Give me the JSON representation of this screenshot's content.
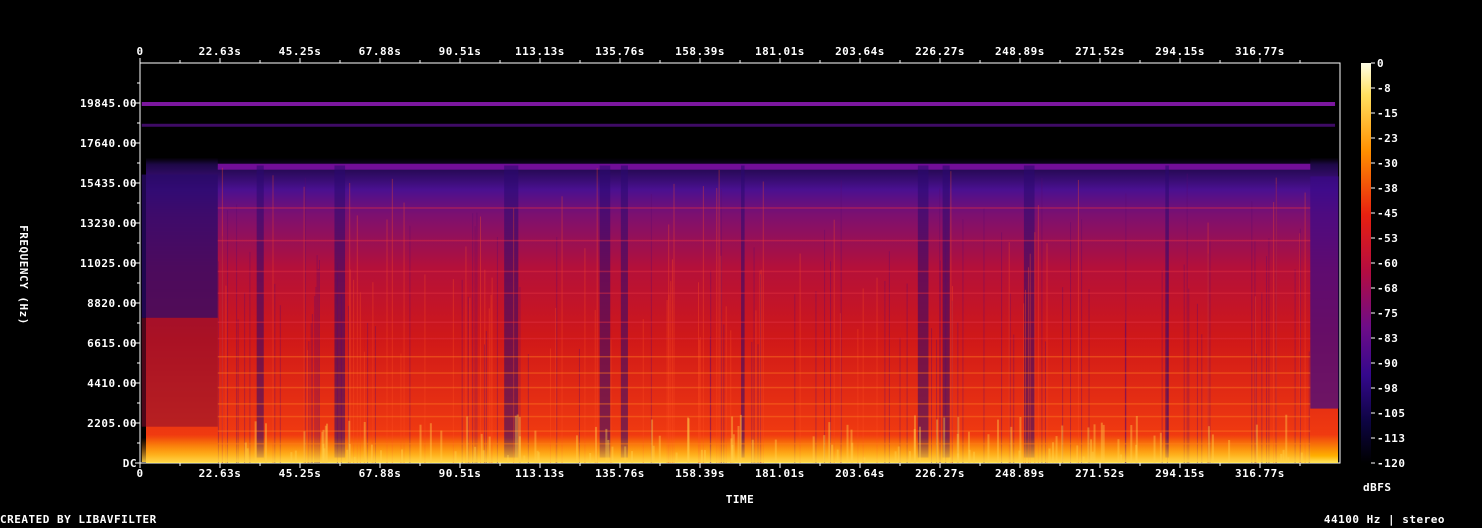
{
  "chart_data": {
    "type": "heatmap",
    "xlabel": "TIME",
    "ylabel": "FREQUENCY (Hz)",
    "x_ticks": [
      "0",
      "22.63s",
      "45.25s",
      "67.88s",
      "90.51s",
      "113.13s",
      "135.76s",
      "158.39s",
      "181.01s",
      "203.64s",
      "226.27s",
      "248.89s",
      "271.52s",
      "294.15s",
      "316.77s"
    ],
    "x_tick_seconds": [
      0,
      22.63,
      45.25,
      67.88,
      90.51,
      113.13,
      135.76,
      158.39,
      181.01,
      203.64,
      226.27,
      248.89,
      271.52,
      294.15,
      316.77
    ],
    "xlim": [
      0,
      339.4
    ],
    "y_ticks": [
      "DC",
      "2205.00",
      "4410.00",
      "6615.00",
      "8820.00",
      "11025.00",
      "13230.00",
      "15435.00",
      "17640.00",
      "19845.00"
    ],
    "y_tick_hz": [
      0,
      2205,
      4410,
      6615,
      8820,
      11025,
      13230,
      15435,
      17640,
      19845
    ],
    "ylim": [
      0,
      22050
    ],
    "colorbar": {
      "label": "dBFS",
      "ticks": [
        "0",
        "-8",
        "-15",
        "-23",
        "-30",
        "-38",
        "-45",
        "-53",
        "-60",
        "-68",
        "-75",
        "-83",
        "-90",
        "-98",
        "-105",
        "-113",
        "-120"
      ],
      "range": [
        -120,
        0
      ]
    },
    "colors": {
      "low": "#000000",
      "mid_low": "#4b0f8c",
      "mid": "#c81414",
      "mid_high": "#ff8c00",
      "high": "#ffffd0"
    }
  },
  "footer": {
    "credit": "CREATED BY LIBAVFILTER",
    "info": "44100 Hz | stereo"
  }
}
